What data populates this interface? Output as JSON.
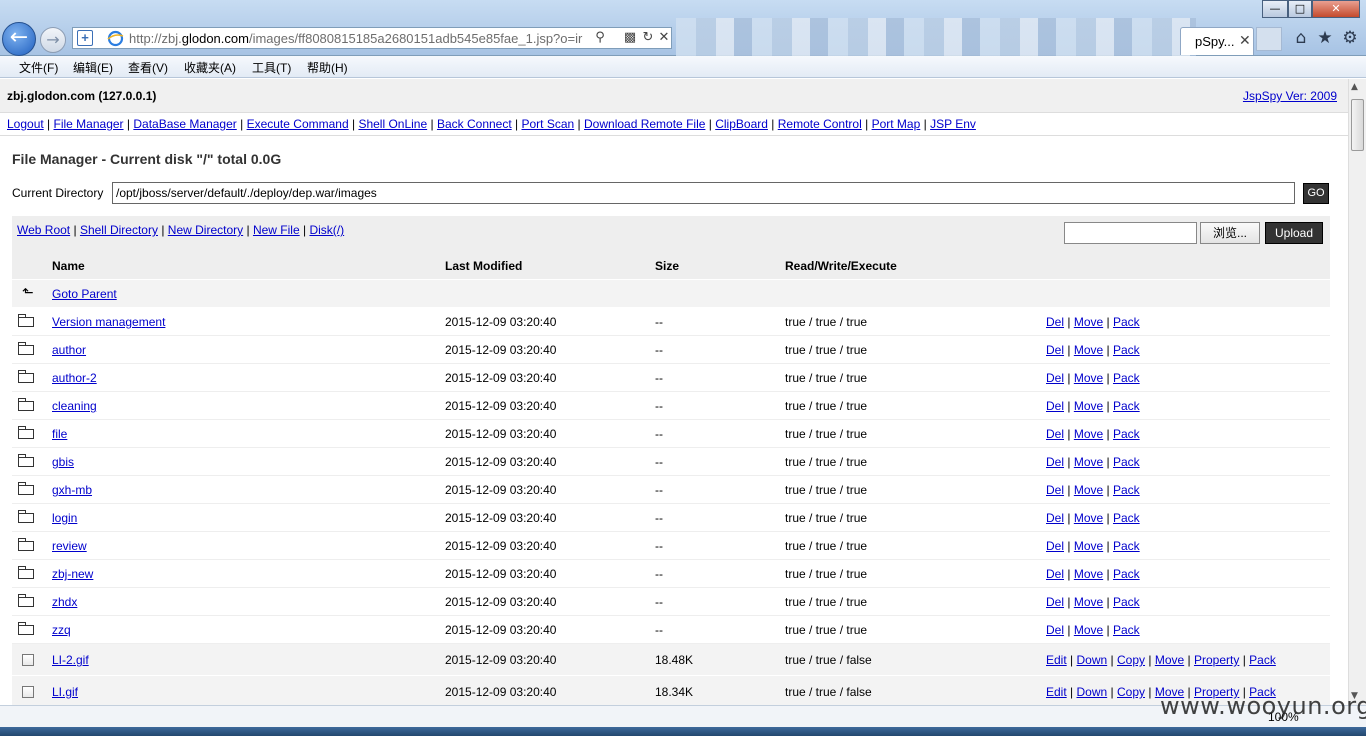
{
  "browser": {
    "url_prefix": "http://zbj.",
    "url_host": "glodon.com",
    "url_rest": "/images/ff8080815185a2680151adb545e85fae_1.jsp?o=ir",
    "tab_label": "pSpy...",
    "zoom": "100%",
    "menu": [
      "文件(F)",
      "编辑(E)",
      "查看(V)",
      "收藏夹(A)",
      "工具(T)",
      "帮助(H)"
    ]
  },
  "header": {
    "host": "zbj.glodon.com (127.0.0.1)",
    "version": "JspSpy Ver: 2009"
  },
  "nav": [
    "Logout",
    "File Manager",
    "DataBase Manager",
    "Execute Command",
    "Shell OnLine",
    "Back Connect",
    "Port Scan",
    "Download Remote File",
    "ClipBoard",
    "Remote Control",
    "Port Map",
    "JSP Env"
  ],
  "file_manager": {
    "title": "File Manager - Current disk \"/\" total 0.0G",
    "current_directory_label": "Current Directory",
    "current_directory": "/opt/jboss/server/default/./deploy/dep.war/images",
    "go_label": "GO",
    "tools": [
      "Web Root",
      "Shell Directory",
      "New Directory",
      "New File",
      "Disk(/)"
    ],
    "browse_label": "浏览...",
    "upload_label": "Upload"
  },
  "table": {
    "headers": {
      "name": "Name",
      "modified": "Last Modified",
      "size": "Size",
      "rwx": "Read/Write/Execute"
    },
    "goto_parent": "Goto Parent",
    "dir_actions": [
      "Del",
      "Move",
      "Pack"
    ],
    "file_actions": [
      "Edit",
      "Down",
      "Copy",
      "Move",
      "Property",
      "Pack"
    ],
    "dirs": [
      {
        "name": "Version management",
        "modified": "2015-12-09 03:20:40",
        "size": "--",
        "rwx": "true / true / true"
      },
      {
        "name": "author",
        "modified": "2015-12-09 03:20:40",
        "size": "--",
        "rwx": "true / true / true"
      },
      {
        "name": "author-2",
        "modified": "2015-12-09 03:20:40",
        "size": "--",
        "rwx": "true / true / true"
      },
      {
        "name": "cleaning",
        "modified": "2015-12-09 03:20:40",
        "size": "--",
        "rwx": "true / true / true"
      },
      {
        "name": "file",
        "modified": "2015-12-09 03:20:40",
        "size": "--",
        "rwx": "true / true / true"
      },
      {
        "name": "gbis",
        "modified": "2015-12-09 03:20:40",
        "size": "--",
        "rwx": "true / true / true"
      },
      {
        "name": "gxh-mb",
        "modified": "2015-12-09 03:20:40",
        "size": "--",
        "rwx": "true / true / true"
      },
      {
        "name": "login",
        "modified": "2015-12-09 03:20:40",
        "size": "--",
        "rwx": "true / true / true"
      },
      {
        "name": "review",
        "modified": "2015-12-09 03:20:40",
        "size": "--",
        "rwx": "true / true / true"
      },
      {
        "name": "zbj-new",
        "modified": "2015-12-09 03:20:40",
        "size": "--",
        "rwx": "true / true / true"
      },
      {
        "name": "zhdx",
        "modified": "2015-12-09 03:20:40",
        "size": "--",
        "rwx": "true / true / true"
      },
      {
        "name": "zzq",
        "modified": "2015-12-09 03:20:40",
        "size": "--",
        "rwx": "true / true / true"
      }
    ],
    "files": [
      {
        "name": "LI-2.gif",
        "modified": "2015-12-09 03:20:40",
        "size": "18.48K",
        "rwx": "true / true / false"
      },
      {
        "name": "LI.gif",
        "modified": "2015-12-09 03:20:40",
        "size": "18.34K",
        "rwx": "true / true / false"
      }
    ]
  },
  "watermark": "www.wooyun.org"
}
